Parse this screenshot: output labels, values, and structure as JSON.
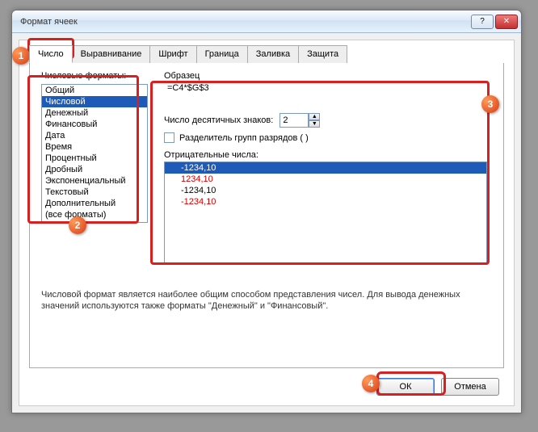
{
  "window": {
    "title": "Формат ячеек"
  },
  "tabs": {
    "items": [
      {
        "label": "Число"
      },
      {
        "label": "Выравнивание"
      },
      {
        "label": "Шрифт"
      },
      {
        "label": "Граница"
      },
      {
        "label": "Заливка"
      },
      {
        "label": "Защита"
      }
    ],
    "active_index": 0
  },
  "formats": {
    "label": "Числовые форматы:",
    "items": [
      "Общий",
      "Числовой",
      "Денежный",
      "Финансовый",
      "Дата",
      "Время",
      "Процентный",
      "Дробный",
      "Экспоненциальный",
      "Текстовый",
      "Дополнительный",
      "(все форматы)"
    ],
    "selected_index": 1
  },
  "sample": {
    "label": "Образец",
    "value": "=C4*$G$3"
  },
  "decimals": {
    "label": "Число десятичных знаков:",
    "value": "2"
  },
  "separator": {
    "label": "Разделитель групп разрядов ( )",
    "checked": false
  },
  "negatives": {
    "label": "Отрицательные числа:",
    "items": [
      {
        "text": "-1234,10",
        "color": "#d00000"
      },
      {
        "text": "1234,10",
        "color": "#d00000"
      },
      {
        "text": "-1234,10",
        "color": "#000000"
      },
      {
        "text": "-1234,10",
        "color": "#d00000"
      }
    ],
    "selected_index": 0
  },
  "description": "Числовой формат является наиболее общим способом представления чисел. Для вывода денежных значений используются также форматы \"Денежный\" и \"Финансовый\".",
  "buttons": {
    "ok": "ОК",
    "cancel": "Отмена"
  },
  "annotations": {
    "b1": "1",
    "b2": "2",
    "b3": "3",
    "b4": "4"
  }
}
